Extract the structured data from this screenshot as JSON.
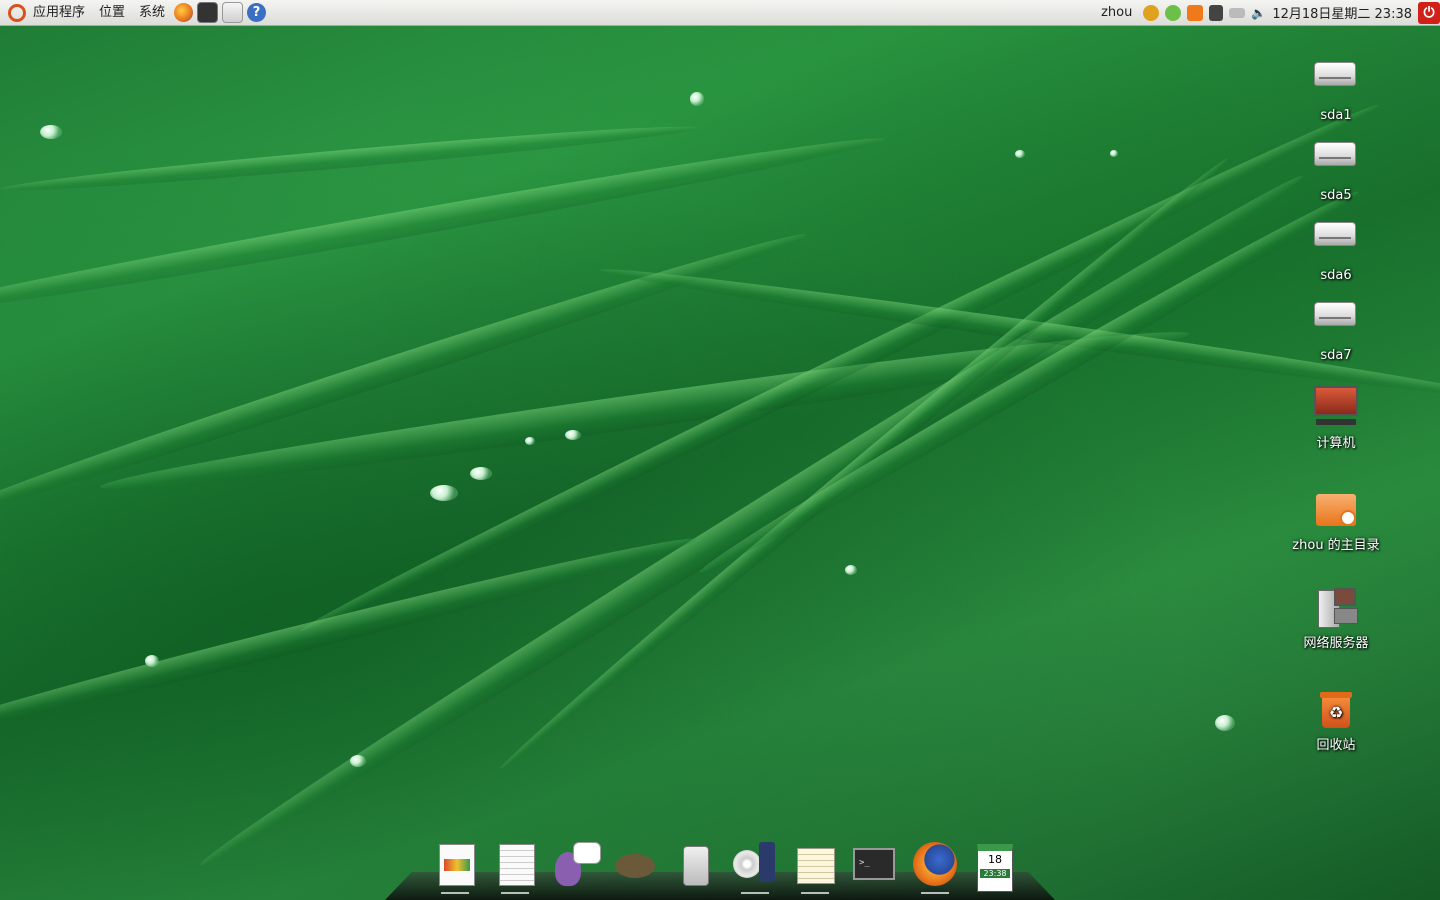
{
  "panel": {
    "menus": [
      "应用程序",
      "位置",
      "系统"
    ],
    "launchers": [
      {
        "icon": "firefox-icon",
        "color": "#e8731a"
      },
      {
        "icon": "terminal-icon",
        "color": "#333333"
      },
      {
        "icon": "mail-icon",
        "color": "#dcdcdc"
      },
      {
        "icon": "help-icon",
        "color": "#3a6fc4"
      }
    ],
    "user": "zhou",
    "clock": "12月18日星期二 23:38"
  },
  "desktop_icons": [
    {
      "label": "sda1",
      "icon": "drive-icon"
    },
    {
      "label": "sda5",
      "icon": "drive-icon"
    },
    {
      "label": "sda6",
      "icon": "drive-icon"
    },
    {
      "label": "sda7",
      "icon": "drive-icon"
    },
    {
      "label": "计算机",
      "icon": "computer-icon"
    },
    {
      "label": "zhou 的主目录",
      "icon": "home-folder-icon"
    },
    {
      "label": "网络服务器",
      "icon": "network-servers-icon"
    },
    {
      "label": "回收站",
      "icon": "trash-icon"
    }
  ],
  "dock": [
    {
      "icon": "presentation-icon",
      "color": "#d84a2a"
    },
    {
      "icon": "document-icon",
      "color": "#f2f2f2"
    },
    {
      "icon": "pidgin-icon",
      "color": "#8a5fb0"
    },
    {
      "icon": "gimp-icon",
      "color": "#6b5a3a"
    },
    {
      "icon": "disk-utility-icon",
      "color": "#cfcfcf"
    },
    {
      "icon": "media-player-icon",
      "color": "#4a6a9a"
    },
    {
      "icon": "text-editor-icon",
      "color": "#f6f0d0"
    },
    {
      "icon": "terminal-icon",
      "color": "#2a2a2a"
    },
    {
      "icon": "firefox-icon",
      "color": "#e8731a"
    },
    {
      "icon": "calendar-icon",
      "color": "#3a9a4a",
      "day": "18",
      "time": "23:38"
    }
  ]
}
